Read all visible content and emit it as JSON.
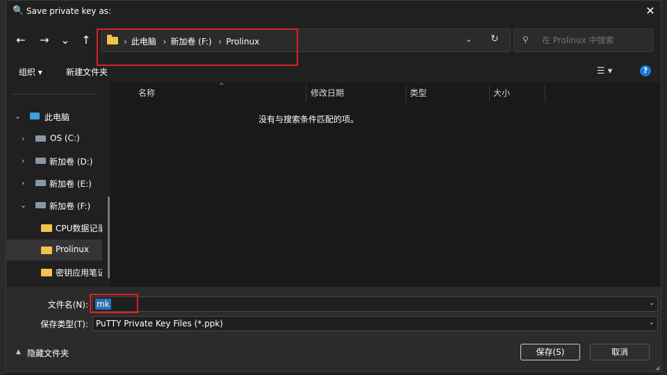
{
  "dialog": {
    "title": "Save private key as:",
    "close_label": "✕"
  },
  "nav": {
    "back": "←",
    "forward": "→",
    "recent": "⌄",
    "up": "↑"
  },
  "address": {
    "crumbs": [
      "此电脑",
      "新加卷 (F:)",
      "Prolinux"
    ],
    "separator": "›"
  },
  "search": {
    "placeholder": "在 Prolinux 中搜索"
  },
  "toolbar": {
    "organize": "组织 ▾",
    "new_folder": "新建文件夹",
    "view_icon": "☰ ▾",
    "help": "?"
  },
  "sidebar": {
    "items": [
      {
        "label": "此电脑",
        "icon": "computer-icon",
        "chevron": "⌄"
      },
      {
        "label": "OS (C:)",
        "icon": "windows-drive-icon",
        "chevron": "›"
      },
      {
        "label": "新加卷 (D:)",
        "icon": "drive-icon",
        "chevron": "›"
      },
      {
        "label": "新加卷 (E:)",
        "icon": "drive-icon",
        "chevron": "›"
      },
      {
        "label": "新加卷 (F:)",
        "icon": "drive-icon",
        "chevron": "⌄"
      },
      {
        "label": "CPU数据记录",
        "icon": "folder-icon"
      },
      {
        "label": "Prolinux",
        "icon": "folder-icon",
        "selected": true
      },
      {
        "label": "密钥应用笔记",
        "icon": "folder-icon"
      }
    ]
  },
  "columns": [
    "名称",
    "修改日期",
    "类型",
    "大小"
  ],
  "empty_message": "没有与搜索条件匹配的项。",
  "form": {
    "filename_label": "文件名(N):",
    "filename_value": "mk",
    "filetype_label": "保存类型(T):",
    "filetype_value": "PuTTY Private Key Files (*.ppk)"
  },
  "footer": {
    "hide_folders": "隐藏文件夹",
    "save": "保存(S)",
    "cancel": "取消"
  },
  "colors": {
    "accent": "#1e78d2",
    "highlight": "#e02020",
    "folder": "#f2c14e"
  }
}
